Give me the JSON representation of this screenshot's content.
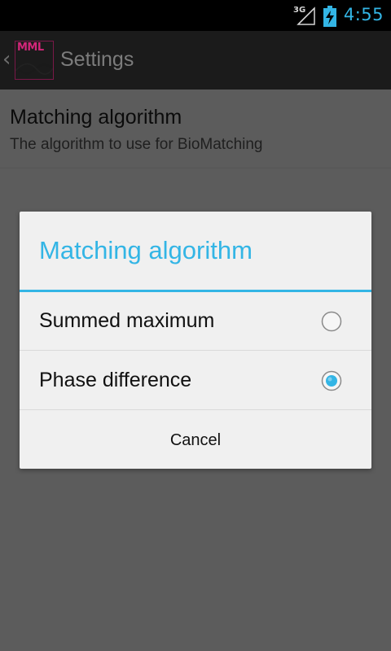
{
  "status_bar": {
    "network": "3G",
    "time": "4:55",
    "accent_color": "#33b5e5",
    "icons": [
      "signal-icon",
      "battery-charging-icon"
    ]
  },
  "action_bar": {
    "logo_text": "MML",
    "title": "Settings",
    "up_icon": "chevron-left-icon"
  },
  "preference": {
    "title": "Matching algorithm",
    "summary": "The algorithm to use for BioMatching"
  },
  "dialog": {
    "title": "Matching algorithm",
    "options": [
      {
        "label": "Summed maximum",
        "selected": false
      },
      {
        "label": "Phase difference",
        "selected": true
      }
    ],
    "cancel_label": "Cancel"
  }
}
